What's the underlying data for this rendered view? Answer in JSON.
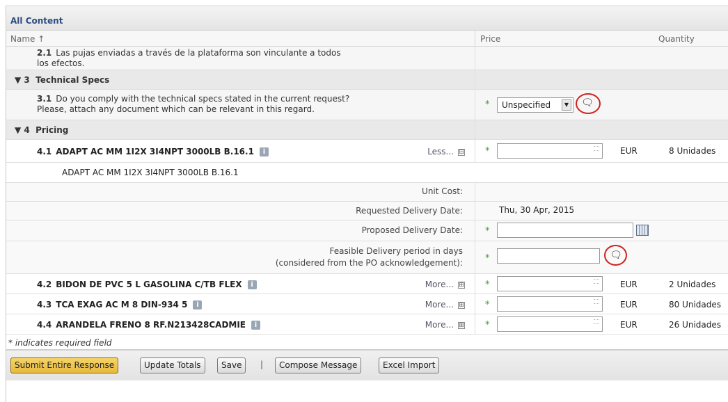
{
  "header": {
    "title": "All Content"
  },
  "columns": {
    "name": "Name ↑",
    "price": "Price",
    "quantity": "Quantity"
  },
  "q21": {
    "number": "2.1",
    "text_line1": "Las pujas enviadas a través de la plataforma son vinculante a todos",
    "text_line2": "los efectos."
  },
  "section3": {
    "toggle": "▼",
    "number": "3",
    "title": "Technical Specs"
  },
  "q31": {
    "number": "3.1",
    "text_line1": "Do you comply with the technical specs stated in the current request?",
    "text_line2": "Please, attach any document which can be relevant in this regard.",
    "required_mark": "*",
    "select_value": "Unspecified",
    "arrow": "▼",
    "comment_icon": "🗨"
  },
  "section4": {
    "toggle": "▼",
    "number": "4",
    "title": "Pricing"
  },
  "item41": {
    "number": "4.1",
    "name": "ADAPT AC MM  1I2X  3I4NPT 3000LB B.16.1",
    "info": "i",
    "toggle_label": "Less...",
    "toggle_symbol": "⊟",
    "required_mark": "*",
    "price_value": "",
    "currency": "EUR",
    "quantity": "8 Unidades",
    "description": "ADAPT AC MM  1I2X  3I4NPT 3000LB B.16.1"
  },
  "details": {
    "unit_cost_label": "Unit Cost:",
    "requested_label": "Requested Delivery Date:",
    "requested_value": "Thu, 30 Apr, 2015",
    "proposed_label": "Proposed Delivery Date:",
    "proposed_value": "",
    "feasible_label_line1": "Feasible Delivery period in days",
    "feasible_label_line2": "(considered from the PO acknowledgement):",
    "feasible_value": "",
    "required_mark": "*"
  },
  "item42": {
    "number": "4.2",
    "name": "BIDON DE PVC 5 L GASOLINA  C/TB FLEX",
    "info": "i",
    "toggle_label": "More...",
    "toggle_symbol": "⊞",
    "required_mark": "*",
    "currency": "EUR",
    "quantity": "2 Unidades"
  },
  "item43": {
    "number": "4.3",
    "name": "TCA EXAG AC M 8    DIN-934 5",
    "info": "i",
    "toggle_label": "More...",
    "toggle_symbol": "⊞",
    "required_mark": "*",
    "currency": "EUR",
    "quantity": "80 Unidades"
  },
  "item44": {
    "number": "4.4",
    "name": "ARANDELA FRENO  8    RF.N213428CADMIE",
    "info": "i",
    "toggle_label": "More...",
    "toggle_symbol": "⊞",
    "required_mark": "*",
    "currency": "EUR",
    "quantity": "26 Unidades"
  },
  "footer": {
    "note": "* indicates required field"
  },
  "toolbar": {
    "submit": "Submit Entire Response",
    "update": "Update Totals",
    "save": "Save",
    "separator": "|",
    "compose": "Compose Message",
    "excel": "Excel Import"
  }
}
